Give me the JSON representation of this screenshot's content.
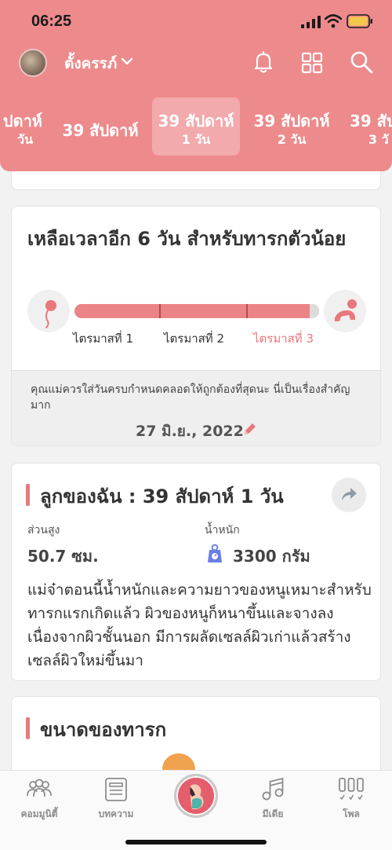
{
  "status_bar": {
    "time": "06:25"
  },
  "header": {
    "username": "ตั้งครรภ์",
    "weeks": [
      {
        "line1": "ปดาห์",
        "line2": "วัน"
      },
      {
        "line1": "39 สัปดาห์",
        "line2": ""
      },
      {
        "line1": "39 สัปดาห์",
        "line2": "1 วัน"
      },
      {
        "line1": "39 สัปดาห์",
        "line2": "2 วัน"
      },
      {
        "line1": "39 สัป",
        "line2": "3 วั"
      }
    ]
  },
  "countdown": {
    "title": "เหลือเวลาอีก 6 วัน สำหรับทารกตัวน้อย",
    "trimesters": [
      "ไตรมาสที่ 1",
      "ไตรมาสที่ 2",
      "ไตรมาสที่ 3"
    ],
    "progress_fraction": 0.97,
    "note": "คุณแม่ควรใส่วันครบกำหนดคลอดให้ถูกต้องที่สุดนะ นี่เป็นเรื่องสำคัญมาก",
    "due_date": "27 มิ.ย., 2022"
  },
  "baby": {
    "title": "ลูกของฉัน : 39 สัปดาห์ 1  วัน",
    "height_label": "ส่วนสูง",
    "height_value": "50.7 ซม.",
    "weight_label": "น้ำหนัก",
    "weight_value": "3300 กรัม",
    "description": "แม่จ๋าตอนนี้น้ำหนักและความยาวของหนูเหมาะสำหรับทารกแรกเกิดแล้ว ผิวของหนูก็หนาขึ้นและจางลง เนื่องจากผิวชั้นนอก มีการผลัดเซลล์ผิวเก่าแล้วสร้างเซลล์ผิวใหม่ขึ้นมา"
  },
  "size_section": {
    "title": "ขนาดของทารก"
  },
  "tabbar": {
    "community": "คอมมูนิตี้",
    "articles": "บทความ",
    "media": "มีเดีย",
    "poll": "โพล"
  },
  "colors": {
    "brand": "#ed8a8c",
    "accent": "#e8787c"
  }
}
